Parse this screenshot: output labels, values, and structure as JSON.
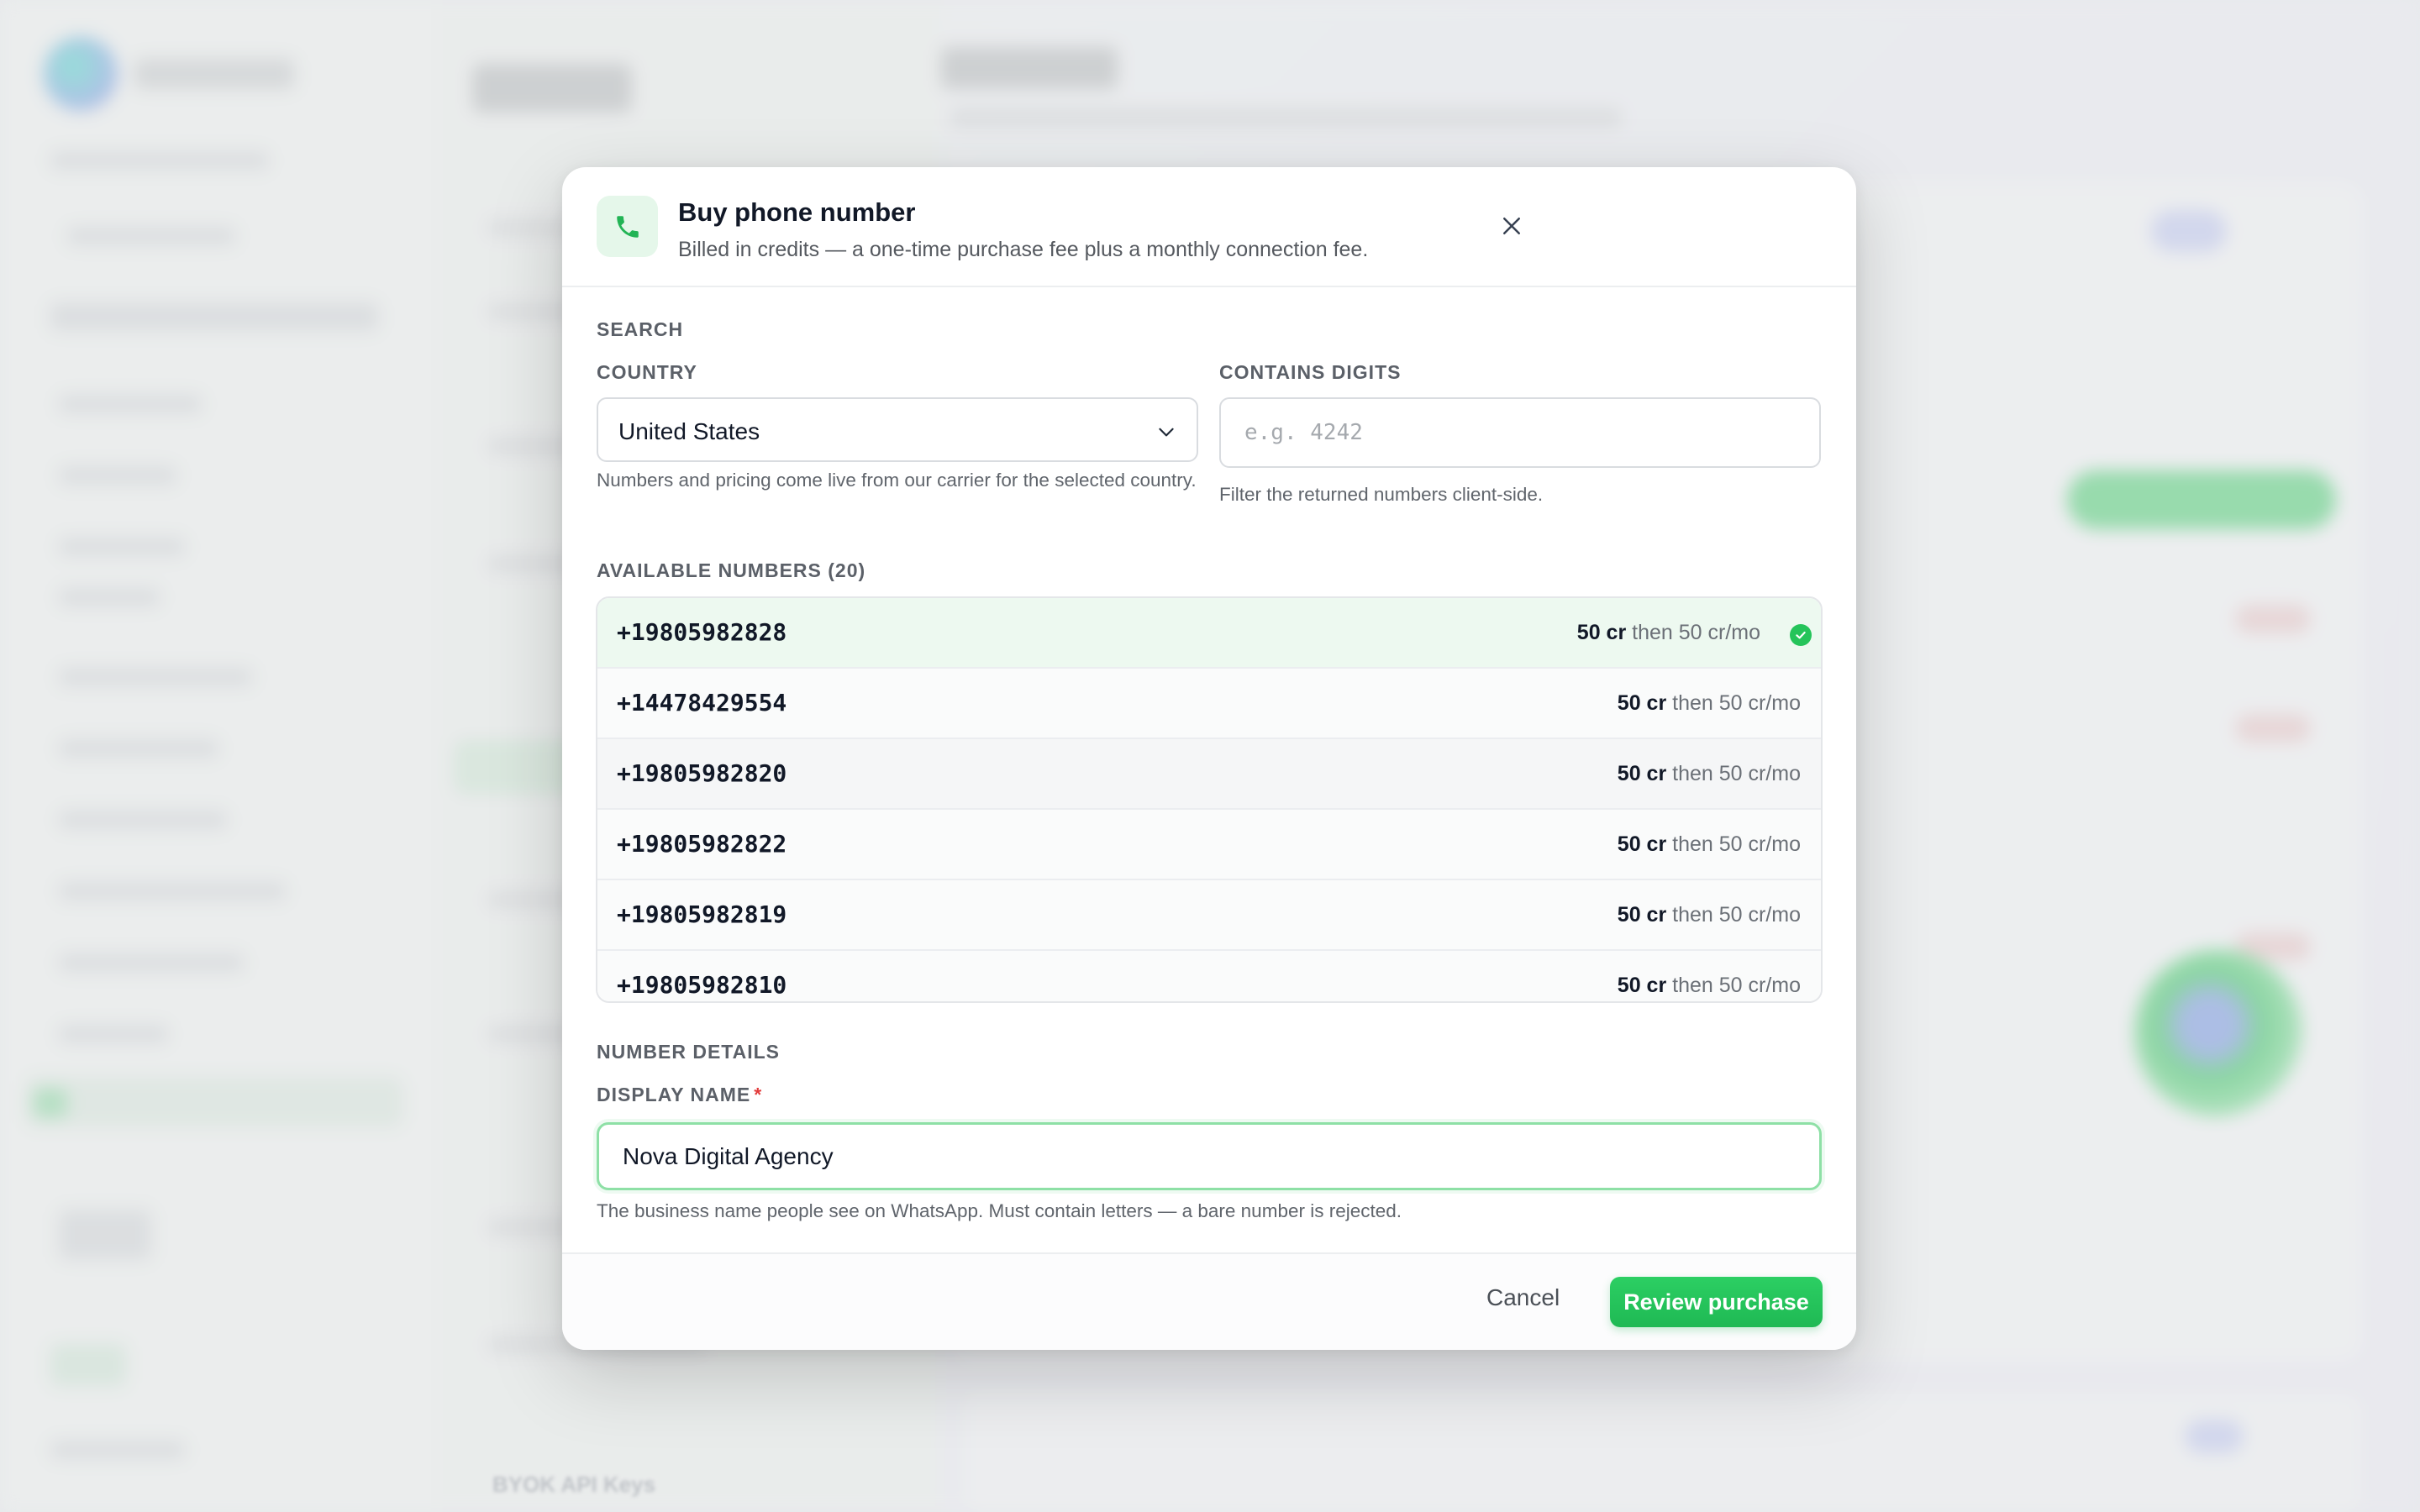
{
  "background": {
    "nav_item": "BYOK API Keys"
  },
  "modal": {
    "title": "Buy phone number",
    "subtitle": "Billed in credits — a one-time purchase fee plus a monthly connection fee.",
    "icon": "phone-icon",
    "close_icon": "close-icon",
    "accent_color": "#25c45a"
  },
  "search": {
    "section_label": "SEARCH",
    "country_label": "COUNTRY",
    "country_value": "United States",
    "country_help": "Numbers and pricing come live from our carrier for the selected country.",
    "digits_label": "CONTAINS DIGITS",
    "digits_placeholder": "e.g. 4242",
    "digits_value": "",
    "digits_help": "Filter the returned numbers client-side."
  },
  "available": {
    "label": "AVAILABLE NUMBERS (20)",
    "numbers": [
      {
        "number": "+19805982828",
        "price": "50 cr",
        "monthly": "then 50 cr/mo",
        "selected": true
      },
      {
        "number": "+14478429554",
        "price": "50 cr",
        "monthly": "then 50 cr/mo",
        "selected": false
      },
      {
        "number": "+19805982820",
        "price": "50 cr",
        "monthly": "then 50 cr/mo",
        "selected": false
      },
      {
        "number": "+19805982822",
        "price": "50 cr",
        "monthly": "then 50 cr/mo",
        "selected": false
      },
      {
        "number": "+19805982819",
        "price": "50 cr",
        "monthly": "then 50 cr/mo",
        "selected": false
      },
      {
        "number": "+19805982810",
        "price": "50 cr",
        "monthly": "then 50 cr/mo",
        "selected": false
      }
    ]
  },
  "details": {
    "section_label": "NUMBER DETAILS",
    "display_name_label": "DISPLAY NAME",
    "required_mark": "*",
    "display_name_value": "Nova Digital Agency",
    "display_name_help": "The business name people see on WhatsApp. Must contain letters — a bare number is rejected."
  },
  "footer": {
    "cancel_label": "Cancel",
    "review_label": "Review purchase"
  }
}
